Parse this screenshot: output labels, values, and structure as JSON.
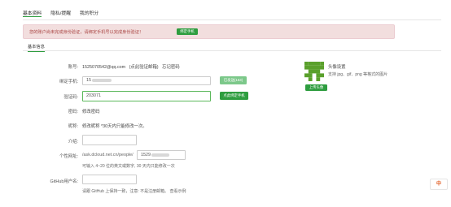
{
  "tabs": [
    {
      "label": "基本资料",
      "active": true
    },
    {
      "label": "隐私/提醒",
      "active": false
    },
    {
      "label": "我的积分",
      "active": false
    }
  ],
  "alert": {
    "text": "您的账户尚未完成身份验证，请绑定手机号以完成身份验证！",
    "button": "绑定手机"
  },
  "basic_tab": "基本信息",
  "account": {
    "label": "账号:",
    "value": "1525070542@qq.com",
    "note": "(点此验证邮箱)",
    "link": "忘记密码"
  },
  "phone": {
    "label": "绑定手机:",
    "value": "15",
    "button": "已发送(163)"
  },
  "code": {
    "label": "验证码:",
    "value": "203071",
    "button": "点此绑定手机"
  },
  "password": {
    "label": "密码:",
    "link": "修改密码"
  },
  "nickname": {
    "label": "昵称:",
    "value": "修改昵称 *30天内只能修改一次。"
  },
  "intro": {
    "label": "介绍:",
    "value": ""
  },
  "personal_url": {
    "label": "个性网址:",
    "prefix": "/ask.dcloud.net.cn/people/",
    "value": "1529",
    "hint": "可输入 4~20 位的英文或数字, 30 天内只能修改一次"
  },
  "github": {
    "label": "GitHub用户名:",
    "value": "",
    "hint": "请跟 GitHub 上保持一致，注意: 不是注册邮箱。 查看示例"
  },
  "avatar": {
    "title": "头像设置",
    "subtitle": "支持 jpg、gif、png 等格式的图片",
    "button": "上传头像",
    "color": "#5aa02c"
  },
  "colors": {
    "accent": "#2e9d3f",
    "alert_bg": "#f2dede",
    "alert_text": "#a94442"
  },
  "toolbar": {
    "label": "中"
  }
}
